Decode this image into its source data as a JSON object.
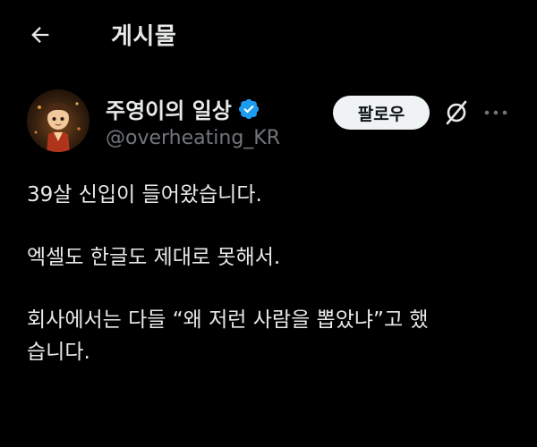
{
  "header": {
    "back_icon": "arrow-left-icon",
    "title": "게시물"
  },
  "author": {
    "avatar_icon": "avatar-image",
    "display_name": "주영이의 일상",
    "verified_icon": "verified-badge-icon",
    "handle": "@overheating_KR"
  },
  "actions": {
    "follow_label": "팔로우",
    "grok_icon": "grok-icon",
    "more_icon": "more-horizontal-icon"
  },
  "post": {
    "paragraphs": [
      [
        "39살 신입이 들어왔습니다."
      ],
      [
        "엑셀도 한글도 제대로 못해서."
      ],
      [
        "회사에서는 다들 “왜 저런 사람을 뽑았냐”고 했",
        "습니다."
      ]
    ]
  },
  "colors": {
    "background": "#000000",
    "text_primary": "#e7e9ea",
    "text_secondary": "#71767b",
    "verified": "#1d9bf0",
    "follow_bg": "#eff3f4",
    "follow_text": "#0f1419"
  }
}
